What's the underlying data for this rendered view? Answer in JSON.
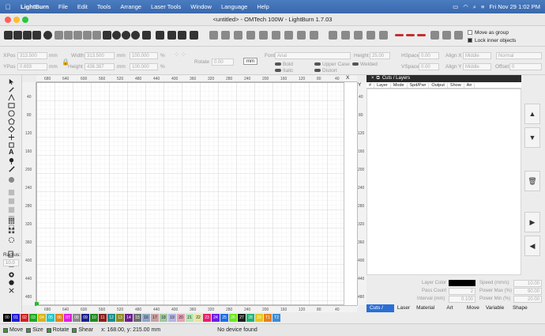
{
  "menubar": {
    "app": "LightBurn",
    "items": [
      "File",
      "Edit",
      "Tools",
      "Arrange",
      "Laser Tools",
      "Window",
      "Language",
      "Help"
    ],
    "clock": "Fri Nov 29  1:02 PM"
  },
  "window": {
    "title": "<untitled> - OMTech 100W - LightBurn 1.7.03"
  },
  "toolbar": {
    "move_as_group": "Move as group",
    "lock_inner_objects": "Lock inner objects"
  },
  "props": {
    "xpos_label": "XPos",
    "xpos_value": "313.500",
    "ypos_label": "YPos",
    "ypos_value": "0.693",
    "width_label": "Width",
    "width_value": "313.500",
    "height_label": "Height",
    "height_value": "436.387",
    "unit_mm": "mm",
    "pct_w": "100.000",
    "pct_h": "100.000",
    "pct_sign": "%",
    "rotate_label": "Rotate",
    "rotate_value": "0.00",
    "mm_button": "mm",
    "font_label": "Font",
    "font_value": "Arial",
    "bold": "Bold",
    "italic": "Italic",
    "upper_case": "Upper Case",
    "distort": "Distort",
    "welded": "Welded",
    "text_height_label": "Height",
    "text_height_value": "25.00",
    "hspace_label": "HSpace",
    "hspace_value": "0.00",
    "vspace_label": "VSpace",
    "vspace_value": "0.00",
    "alignx_label": "Align X",
    "alignx_value": "Middle",
    "aligny_label": "Align Y",
    "aligny_value": "Middle",
    "normal": "Normal",
    "offset_label": "Offset",
    "offset_value": "0"
  },
  "left": {
    "radius_label": "Radius:",
    "radius_value": "10.0"
  },
  "ruler": {
    "top": [
      "680",
      "640",
      "600",
      "560",
      "520",
      "480",
      "440",
      "400",
      "360",
      "320",
      "280",
      "240",
      "200",
      "160",
      "120",
      "80",
      "40",
      "X"
    ],
    "bottom": [
      "680",
      "640",
      "600",
      "560",
      "520",
      "480",
      "440",
      "400",
      "360",
      "320",
      "280",
      "240",
      "200",
      "160",
      "120",
      "80",
      "40"
    ],
    "left": [
      "40",
      "80",
      "120",
      "160",
      "200",
      "240",
      "280",
      "320",
      "360",
      "400",
      "440",
      "480"
    ],
    "right": [
      "Y",
      "40",
      "80",
      "120",
      "160",
      "200",
      "240",
      "280",
      "320",
      "360",
      "400",
      "440",
      "480"
    ]
  },
  "rpanel": {
    "title": "Cuts / Layers",
    "columns": [
      "#",
      "Layer",
      "Mode",
      "Spd/Pwr",
      "Output",
      "Show",
      "Air"
    ],
    "layer_color": "Layer Color",
    "pass_count": "Pass Count",
    "pass_count_value": "2",
    "interval": "Interval (mm)",
    "interval_value": "0.100",
    "speed": "Speed (mm/s)",
    "speed_value": "10.00",
    "power_max": "Power Max (%)",
    "power_max_value": "90.00",
    "power_min": "Power Min (%)",
    "power_min_value": "20.00",
    "tabs": [
      "Cuts / La...",
      "Laser",
      "Material Li...",
      "Art Li...",
      "Move",
      "Variable ...",
      "Shape Prope..."
    ]
  },
  "palette": {
    "labels": [
      "00",
      "01",
      "02",
      "03",
      "04",
      "05",
      "06",
      "07",
      "08",
      "09",
      "10",
      "11",
      "12",
      "13",
      "14",
      "15",
      "16",
      "17",
      "18",
      "19",
      "20",
      "21",
      "22",
      "23",
      "24",
      "25",
      "26",
      "27",
      "28",
      "29",
      "T1",
      "T2"
    ],
    "colors": [
      "#000000",
      "#1f1fd6",
      "#d62020",
      "#1ea81e",
      "#d6b41e",
      "#1ec8c8",
      "#e0851e",
      "#e01ee0",
      "#8a8a8a",
      "#1e1e8c",
      "#1e8c1e",
      "#8c1e1e",
      "#1e8c8c",
      "#8c8c1e",
      "#6b1e8c",
      "#6e6e6e",
      "#8ca6c8",
      "#c8a0a0",
      "#a0c8a0",
      "#b4b4e6",
      "#e6a0b4",
      "#b4e6b4",
      "#e6e6a0",
      "#e61e6e",
      "#6e1ee6",
      "#1e6ee6",
      "#6ee61e",
      "#1e1e1e",
      "#1eb46e",
      "#e6c81e",
      "#e6821e",
      "#3c8cd6"
    ]
  },
  "status": {
    "move": "Move",
    "size": "Size",
    "rotate": "Rotate",
    "shear": "Shear",
    "coords": "x: 168.00, y: 215.00 mm",
    "device": "No device found"
  }
}
